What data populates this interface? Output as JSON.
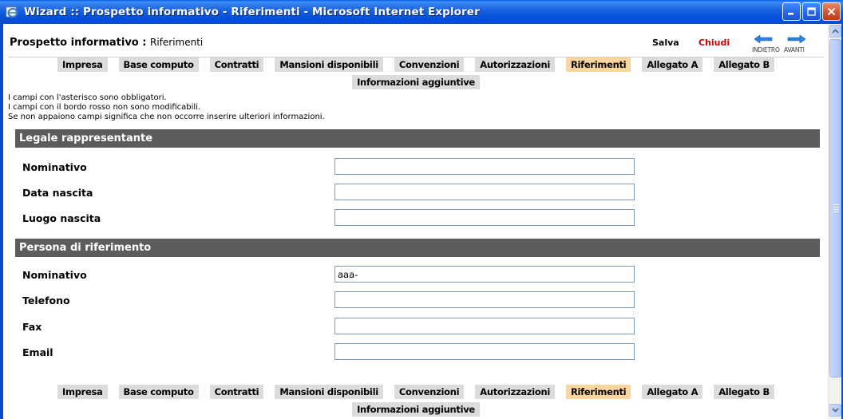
{
  "window": {
    "title": "Wizard :: Prospetto informativo - Riferimenti - Microsoft Internet Explorer"
  },
  "header": {
    "title": "Prospetto informativo :",
    "subtitle": "Riferimenti",
    "save_label": "Salva",
    "close_label": "Chiudi",
    "back_label": "INDIETRO",
    "forward_label": "AVANTI"
  },
  "tabs": [
    {
      "label": "Impresa",
      "active": false
    },
    {
      "label": "Base computo",
      "active": false
    },
    {
      "label": "Contratti",
      "active": false
    },
    {
      "label": "Mansioni disponibili",
      "active": false
    },
    {
      "label": "Convenzioni",
      "active": false
    },
    {
      "label": "Autorizzazioni",
      "active": false
    },
    {
      "label": "Riferimenti",
      "active": true
    },
    {
      "label": "Allegato A",
      "active": false
    },
    {
      "label": "Allegato B",
      "active": false
    },
    {
      "label": "Informazioni aggiuntive",
      "active": false
    }
  ],
  "notes": [
    "I campi con l'asterisco sono obbligatori.",
    "I campi con il bordo rosso non sono modificabili.",
    "Se non appaiono campi significa che non occorre inserire ulteriori informazioni."
  ],
  "legal_rep": {
    "title": "Legale rappresentante",
    "fields": [
      {
        "label": "Nominativo",
        "value": ""
      },
      {
        "label": "Data nascita",
        "value": ""
      },
      {
        "label": "Luogo nascita",
        "value": ""
      }
    ]
  },
  "reference_person": {
    "title": "Persona di riferimento",
    "fields": [
      {
        "label": "Nominativo",
        "value": "aaa-"
      },
      {
        "label": "Telefono",
        "value": ""
      },
      {
        "label": "Fax",
        "value": ""
      },
      {
        "label": "Email",
        "value": ""
      }
    ]
  },
  "colors": {
    "titlebar": "#0b4bc9",
    "tab": "#dcdcdc",
    "tab_active": "#fbd59e",
    "section_header": "#5c5c5c",
    "close_link": "#cc0000"
  }
}
